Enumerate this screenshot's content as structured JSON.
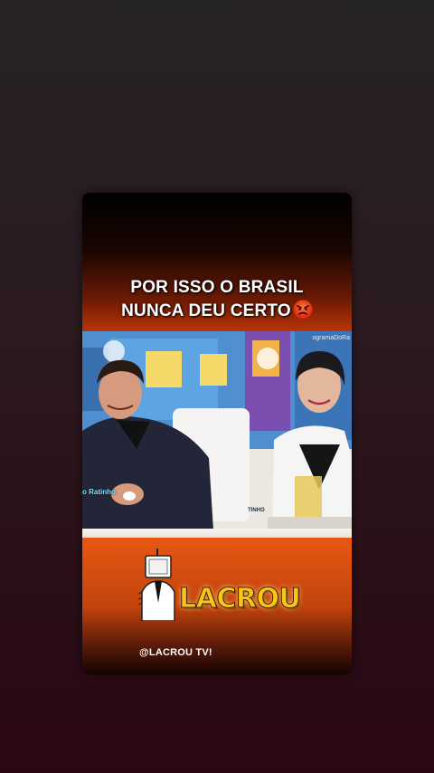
{
  "post": {
    "headline_line1": "POR ISSO O BRASIL",
    "headline_line2": "NUNCA DEU CERTO",
    "headline_emoji": "angry-face-emoji",
    "handle": "@LACROU TV!"
  },
  "video": {
    "name_tag": "o Ratinho",
    "program_tag": "ogramaDoRa",
    "desk_plate": "TINHO"
  },
  "logo": {
    "text": "LACROU",
    "icon": "tv-head-man-icon"
  },
  "colors": {
    "accent_orange": "#ec5a12",
    "logo_yellow": "#f7c718",
    "background_dark": "#2a0714"
  }
}
